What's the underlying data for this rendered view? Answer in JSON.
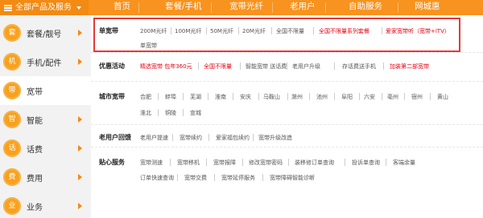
{
  "topnav": {
    "all_products": "全部产品及服务",
    "items": [
      "首页",
      "套餐/手机",
      "宽带光纤",
      "老用户",
      "自助服务",
      "网城惠"
    ]
  },
  "sidebar": {
    "items": [
      {
        "icon_char": "套",
        "label": "套餐/靓号"
      },
      {
        "icon_char": "机",
        "label": "手机/配件"
      },
      {
        "icon_char": "带",
        "label": "宽带"
      },
      {
        "icon_char": "智",
        "label": "智能"
      },
      {
        "icon_char": "话",
        "label": "话费"
      },
      {
        "icon_char": "费",
        "label": "费用"
      },
      {
        "icon_char": "业",
        "label": "业务"
      }
    ]
  },
  "sections": {
    "pure_broadband": {
      "title": "单宽带",
      "links": [
        "200M光纤",
        "100M光纤",
        "50M光纤",
        "20M光纤",
        "全国不限量",
        "全国不限量系列套餐",
        "爱家宽带听（宽带+iTV）",
        "单宽带"
      ]
    },
    "promotions": {
      "title": "优惠活动",
      "links": [
        "精选宽带 包年360元",
        "全国不限量",
        "智能宽带 送话费",
        "老用户升级",
        "存话费送手机",
        "加装第二部宽带"
      ]
    },
    "city_broadband": {
      "title": "城市宽带",
      "links": [
        "合肥",
        "蚌埠",
        "芜湖",
        "淮南",
        "安庆",
        "马鞍山",
        "滁州",
        "池州",
        "阜阳",
        "六安",
        "亳州",
        "宿州",
        "黄山",
        "淮北",
        "铜陵",
        "宣城"
      ]
    },
    "old_user": {
      "title": "老用户回馈",
      "links": [
        "老用户提速",
        "宽带续约",
        "爱家福包续约",
        "宽带升级改造"
      ]
    },
    "care_service": {
      "title": "贴心服务",
      "links": [
        "宽带测速",
        "宽带移机",
        "宽带报障",
        "修改宽带密码",
        "装移修订单查询",
        "投诉单查询",
        "客端余量",
        "订单快速查询",
        "宽带交费",
        "宽带延停服务",
        "宽带障碍智能诊断"
      ]
    }
  },
  "colors": {
    "nav_orange": "#f7931e",
    "accent_red": "#e60012",
    "highlight_border": "#e53935"
  }
}
